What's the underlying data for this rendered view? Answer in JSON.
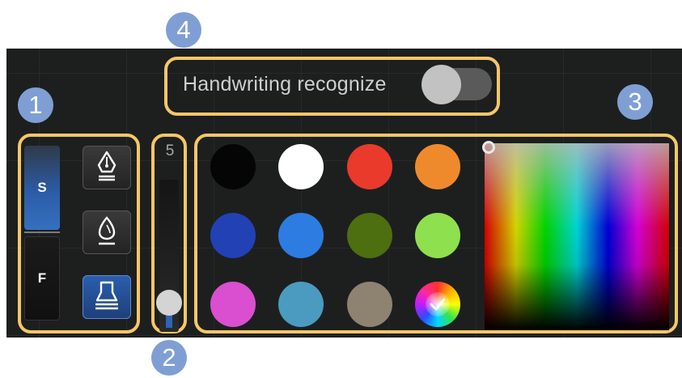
{
  "callouts": {
    "one": "1",
    "two": "2",
    "three": "3",
    "four": "4"
  },
  "handwriting": {
    "label": "Handwriting recognize",
    "enabled": false
  },
  "modes": {
    "stroke_label": "S",
    "fill_label": "F",
    "selected": "S"
  },
  "pens": [
    {
      "icon": "fountain-pen-icon",
      "active": false
    },
    {
      "icon": "brush-pen-icon",
      "active": false
    },
    {
      "icon": "highlighter-icon",
      "active": true
    }
  ],
  "size": {
    "value": "5",
    "level": 0.1
  },
  "palette": {
    "colors": [
      "#050505",
      "#ffffff",
      "#ea3a2b",
      "#ef8a2c",
      "#2241b4",
      "#2d7ce2",
      "#4d6f10",
      "#8fe04e",
      "#d94fd0",
      "#4b9bc0",
      "#8e8270"
    ],
    "custom_icon": "color-wheel-check-icon"
  },
  "colors": {
    "highlight": "#f6c766",
    "badge": "#7f9fd4",
    "accent": "#2e63b8"
  }
}
